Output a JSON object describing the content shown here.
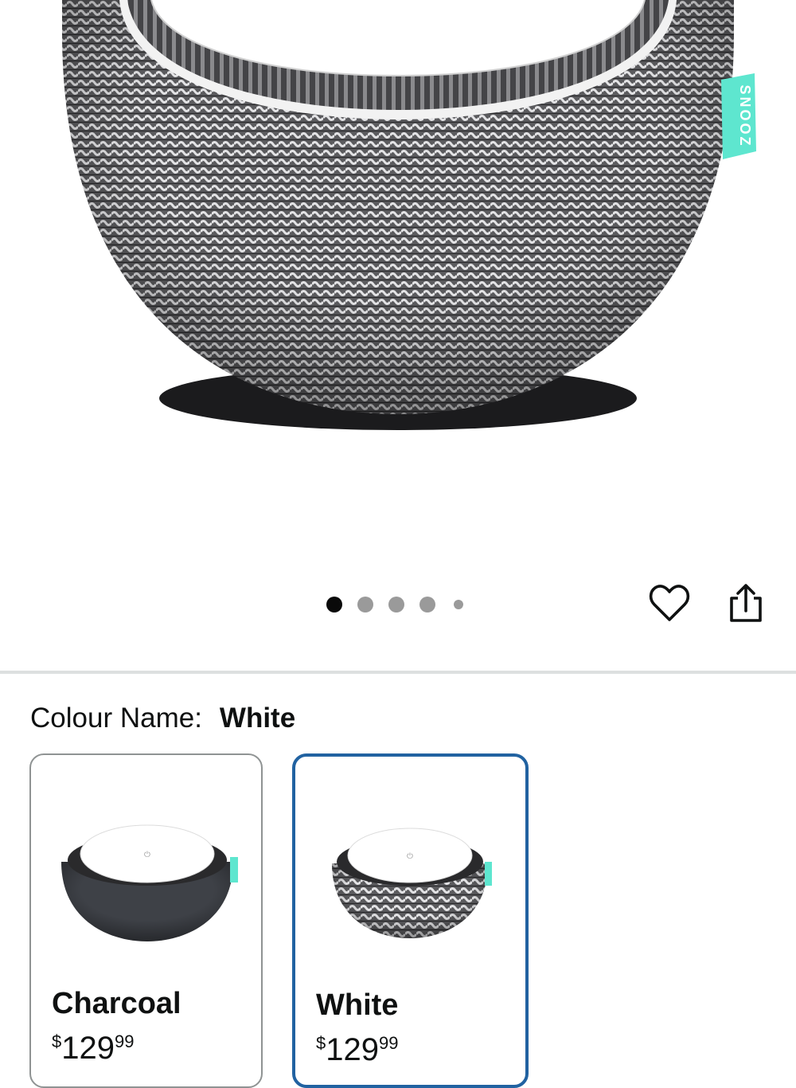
{
  "product_image": {
    "brand_tag": "SNOOZ",
    "alt_icon": "product-white-noise-machine"
  },
  "carousel": {
    "total_images": 5,
    "active_index": 0
  },
  "actions": {
    "wishlist_icon": "heart-icon",
    "share_icon": "share-icon"
  },
  "colour": {
    "label": "Colour Name:",
    "selected": "White"
  },
  "variants": [
    {
      "name": "Charcoal",
      "currency": "$",
      "price_whole": "129",
      "price_fraction": "99",
      "selected": false
    },
    {
      "name": "White",
      "currency": "$",
      "price_whole": "129",
      "price_fraction": "99",
      "selected": true
    }
  ],
  "colors": {
    "selected_border": "#2162a1",
    "unselected_border": "#8f9393",
    "brand_tag": "#5ee6cf",
    "divider": "#dde0e0"
  }
}
